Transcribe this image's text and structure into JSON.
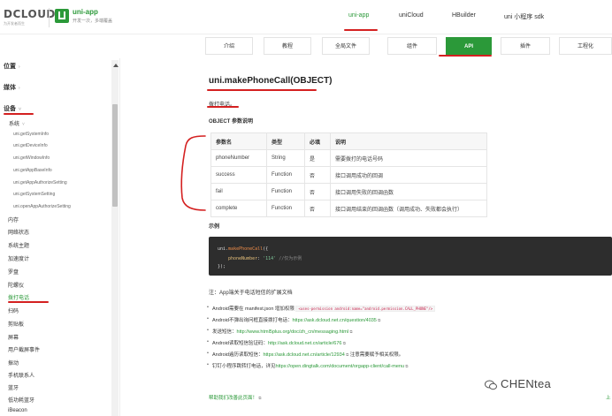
{
  "header": {
    "dcloud_logo": "DCLOUD",
    "dcloud_tagline": "为开发者而生",
    "product_title": "uni-app",
    "product_subtitle": "开发一次，多端覆盖",
    "nav": [
      "uni-app",
      "uniCloud",
      "HBuilder",
      "uni 小程序 sdk"
    ],
    "active_nav": "uni-app"
  },
  "subnav": {
    "items": [
      "介绍",
      "教程",
      "全局文件",
      "组件",
      "API",
      "插件",
      "工程化"
    ],
    "active": "API"
  },
  "sidebar": {
    "sections": [
      "位置",
      "媒体",
      "设备"
    ],
    "device_group": "系统",
    "system_items": [
      "uni.getSystemInfo",
      "uni.getDeviceInfo",
      "uni.getWindowInfo",
      "uni.getAppBaseInfo",
      "uni.getAppAuthorizeSetting",
      "uni.getSystemSetting",
      "uni.openAppAuthorizeSetting"
    ],
    "device_items": [
      "内存",
      "网络状态",
      "系统主题",
      "加速度计",
      "罗盘",
      "陀螺仪",
      "拨打电话",
      "扫码",
      "剪贴板",
      "屏幕",
      "用户截屏事件",
      "振动",
      "手机联系人",
      "蓝牙",
      "低功耗蓝牙",
      "iBeacon"
    ],
    "active_item": "拨打电话"
  },
  "main": {
    "title": "uni.makePhoneCall(OBJECT)",
    "description": "拨打电话。",
    "params_heading": "OBJECT 参数说明",
    "table": {
      "headers": [
        "参数名",
        "类型",
        "必填",
        "说明"
      ],
      "rows": [
        [
          "phoneNumber",
          "String",
          "是",
          "需要拨打的电话号码"
        ],
        [
          "success",
          "Function",
          "否",
          "接口调用成功的回调"
        ],
        [
          "fail",
          "Function",
          "否",
          "接口调用失败的回调函数"
        ],
        [
          "complete",
          "Function",
          "否",
          "接口调用结束的回调函数（调用成功、失败都会执行）"
        ]
      ]
    },
    "example_heading": "示例",
    "code": {
      "line1_obj": "uni.",
      "line1_fn": "makePhoneCall",
      "line1_end": "({",
      "line2_key": "phoneNumber",
      "line2_colon": ": ",
      "line2_val": "'114'",
      "line2_comment": " //仅为示例",
      "line3": "});"
    },
    "note": "注：App端关于电话短信的扩展文档",
    "bullets": [
      {
        "text": "Android需要在 manifest.json 增加权限 ",
        "code": "<uses-permission android:name=\"android.permission.CALL_PHONE\"/>",
        "link": "",
        "after": ""
      },
      {
        "text": "Android不弹出询问框直接拨打电话：",
        "code": "",
        "link": "https://ask.dcloud.net.cn/question/4035",
        "after": ""
      },
      {
        "text": "发送短信：",
        "code": "",
        "link": "http://www.html5plus.org/doc/zh_cn/messaging.html",
        "after": ""
      },
      {
        "text": "Android读取短信验证码：",
        "code": "",
        "link": "http://ask.dcloud.net.cn/article/676",
        "after": ""
      },
      {
        "text": "Android遍历读取短信：",
        "code": "",
        "link": "https://ask.dcloud.net.cn/article/12934",
        "after": " 注意需要赋予相关权限。"
      },
      {
        "text": "钉钉小程序跳转打电话，详见",
        "code": "",
        "link": "https://open.dingtalk.com/document/orgapp-client/call-menu",
        "after": ""
      }
    ],
    "feedback": "帮助我们改善此页面！",
    "prev": "上"
  },
  "watermark": "CHENtea",
  "icons": {
    "external": "external-link-icon",
    "chevron": "chevron-right-icon",
    "wechat": "wechat-icon"
  },
  "colors": {
    "accent": "#2b9939",
    "annotation": "#d42020",
    "code_bg": "#2d2d2d"
  }
}
